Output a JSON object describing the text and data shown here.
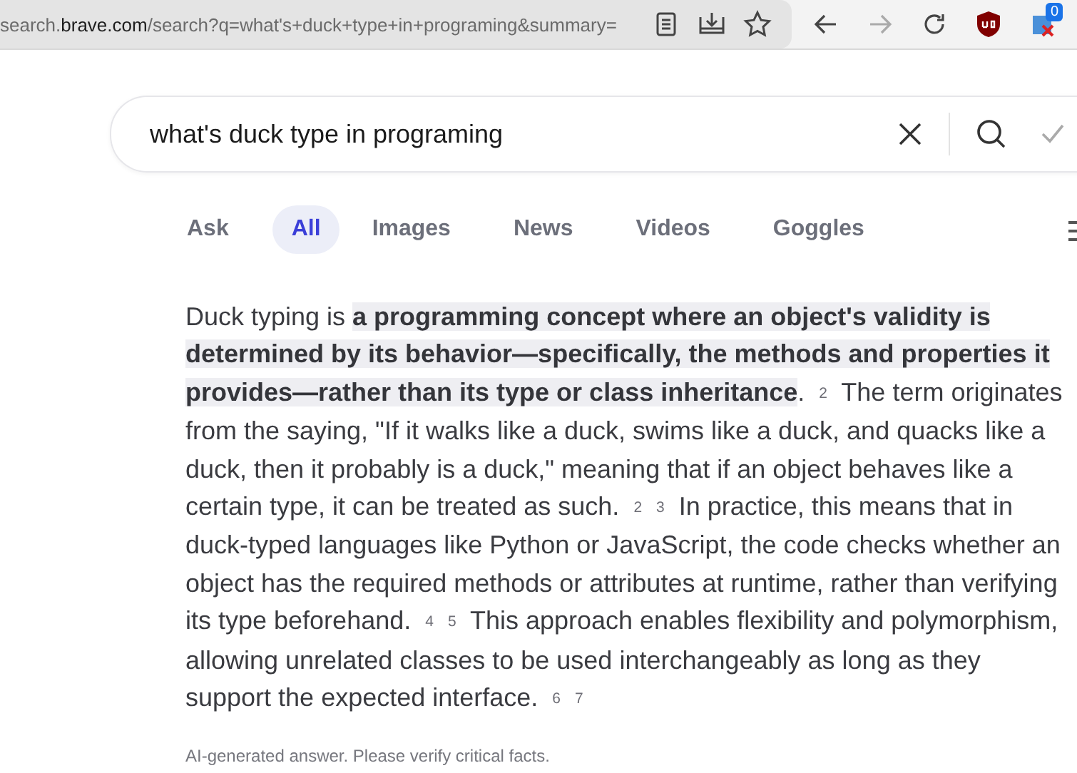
{
  "address_bar": {
    "url": [
      {
        "kind": "dim",
        "text": "search."
      },
      {
        "kind": "host",
        "text": "brave.com"
      },
      {
        "kind": "dim",
        "text": "/search?q=what's+duck+type+in+programing&summary="
      }
    ],
    "extension_badge": "0"
  },
  "search": {
    "value": "what's duck type in programing"
  },
  "tabs": [
    {
      "label": "Ask",
      "selected": false
    },
    {
      "label": "All",
      "selected": true
    },
    {
      "label": "Images",
      "selected": false
    },
    {
      "label": "News",
      "selected": false
    },
    {
      "label": "Videos",
      "selected": false
    },
    {
      "label": "Goggles",
      "selected": false
    }
  ],
  "answer": {
    "segments": [
      {
        "kind": "text",
        "text": "Duck typing is "
      },
      {
        "kind": "highlight",
        "text": "a programming concept where an object's validity is determined by its behavior—specifically, the methods and properties it provides—rather than its type or class inheritance"
      },
      {
        "kind": "text",
        "text": ". "
      },
      {
        "kind": "cite",
        "text": "2"
      },
      {
        "kind": "text",
        "text": " The term originates from the saying, \"If it walks like a duck, swims like a duck, and quacks like a duck, then it probably is a duck,\" meaning that if an object behaves like a certain type, it can be treated as such. "
      },
      {
        "kind": "cite",
        "text": "2"
      },
      {
        "kind": "cite",
        "text": "3"
      },
      {
        "kind": "text",
        "text": " In practice, this means that in duck-typed languages like Python or JavaScript, the code checks whether an object has the required methods or attributes at runtime, rather than verifying its type beforehand. "
      },
      {
        "kind": "cite",
        "text": "4"
      },
      {
        "kind": "cite",
        "text": "5"
      },
      {
        "kind": "text",
        "text": " This approach enables flexibility and polymorphism, allowing unrelated classes to be used interchangeably as long as they support the expected interface. "
      },
      {
        "kind": "cite",
        "text": "6"
      },
      {
        "kind": "cite",
        "text": "7"
      }
    ],
    "disclaimer": "AI-generated answer. Please verify critical facts."
  }
}
